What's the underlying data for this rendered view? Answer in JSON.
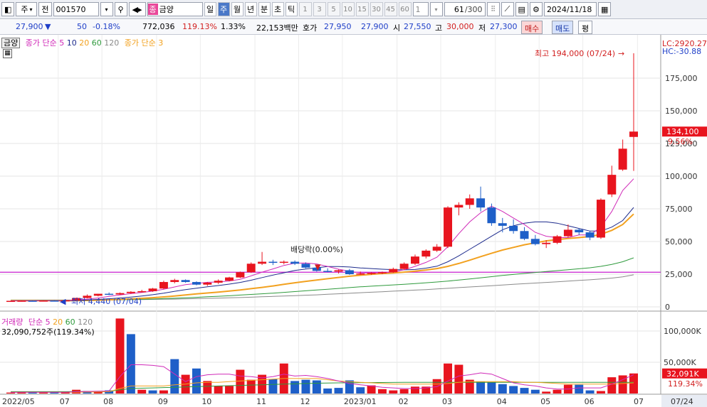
{
  "toolbar": {
    "market": "주",
    "type_label": "전",
    "code": "001570",
    "name": "금양",
    "name_badge": "종",
    "periods": [
      "일",
      "주",
      "월",
      "년",
      "분",
      "초",
      "틱"
    ],
    "active_period": "주",
    "intervals": [
      "1",
      "3",
      "5",
      "10",
      "15",
      "30",
      "45",
      "60"
    ],
    "interval_value": "1",
    "count": "61",
    "count_max": "/300",
    "date": "2024/11/18"
  },
  "quote": {
    "price": "27,900",
    "change": "50",
    "change_pct": "-0.18%",
    "volume": "772,036",
    "vol_ratio": "119.13%",
    "turnover": "1.33%",
    "amount": "22,153백만",
    "hoga_label": "호가",
    "ask": "27,950",
    "bid": "27,900",
    "open_label": "시",
    "open": "27,550",
    "high_label": "고",
    "high": "30,000",
    "low_label": "저",
    "low": "27,300",
    "buy_btn": "매수",
    "sell_btn": "매도",
    "eval_btn": "평"
  },
  "price_panel": {
    "name_tag": "금양",
    "ma_label": "종가 단순",
    "ma_periods": [
      "5",
      "10",
      "20",
      "60",
      "120"
    ],
    "ma_label2": "종가 단순 3",
    "lc": "LC:2920.27",
    "hc": "HC:-30.88",
    "high_annot": "최고 194,000 (07/24)",
    "low_annot": "최저 4,440 (07/04)",
    "dividend_annot": "배당락(0.00%)",
    "last_price_tag": "134,100",
    "last_pct_tag": "9.56%",
    "y_labels": [
      "175,000",
      "150,000",
      "125,000",
      "100,000",
      "75,000",
      "50,000",
      "25,000",
      "0"
    ]
  },
  "volume_panel": {
    "title": "거래량",
    "ma_label": "단순",
    "ma_periods": [
      "5",
      "20",
      "60",
      "120"
    ],
    "value": "32,090,752주(119.34%)",
    "y_labels": [
      "100,000K",
      "50,000K"
    ],
    "last_tag": "32,091K",
    "last_pct": "119.34%"
  },
  "x_axis": [
    "2022/05",
    "07",
    "08",
    "09",
    "10",
    "11",
    "12",
    "2023/01",
    "02",
    "03",
    "04",
    "05",
    "06",
    "07",
    "07/24"
  ],
  "chart_data": {
    "type": "candlestick",
    "ylim": [
      0,
      194000
    ],
    "candles": [
      {
        "o": 4500,
        "h": 4700,
        "l": 4440,
        "c": 4600
      },
      {
        "o": 4600,
        "h": 4800,
        "l": 4500,
        "c": 4700
      },
      {
        "o": 4700,
        "h": 4900,
        "l": 4600,
        "c": 4650
      },
      {
        "o": 4650,
        "h": 4900,
        "l": 4500,
        "c": 4800
      },
      {
        "o": 4800,
        "h": 5000,
        "l": 4600,
        "c": 4700
      },
      {
        "o": 4700,
        "h": 5100,
        "l": 4600,
        "c": 5000
      },
      {
        "o": 5000,
        "h": 7000,
        "l": 4900,
        "c": 6800
      },
      {
        "o": 6800,
        "h": 9500,
        "l": 6500,
        "c": 8500
      },
      {
        "o": 8500,
        "h": 10000,
        "l": 8000,
        "c": 10000
      },
      {
        "o": 10000,
        "h": 11000,
        "l": 9000,
        "c": 9500
      },
      {
        "o": 9500,
        "h": 11000,
        "l": 9200,
        "c": 10500
      },
      {
        "o": 10500,
        "h": 12000,
        "l": 10000,
        "c": 11500
      },
      {
        "o": 11500,
        "h": 13000,
        "l": 11000,
        "c": 12000
      },
      {
        "o": 12000,
        "h": 14500,
        "l": 11500,
        "c": 14000
      },
      {
        "o": 14000,
        "h": 20000,
        "l": 13500,
        "c": 19000
      },
      {
        "o": 19000,
        "h": 21500,
        "l": 18000,
        "c": 20500
      },
      {
        "o": 20500,
        "h": 21000,
        "l": 18500,
        "c": 19000
      },
      {
        "o": 19000,
        "h": 19500,
        "l": 16500,
        "c": 17000
      },
      {
        "o": 17000,
        "h": 19000,
        "l": 16000,
        "c": 18500
      },
      {
        "o": 18500,
        "h": 21000,
        "l": 17500,
        "c": 20000
      },
      {
        "o": 20000,
        "h": 23000,
        "l": 19500,
        "c": 22500
      },
      {
        "o": 22500,
        "h": 27000,
        "l": 22000,
        "c": 26500
      },
      {
        "o": 26500,
        "h": 34000,
        "l": 26000,
        "c": 33000
      },
      {
        "o": 33000,
        "h": 42000,
        "l": 32000,
        "c": 34500
      },
      {
        "o": 34500,
        "h": 36000,
        "l": 32000,
        "c": 34000
      },
      {
        "o": 34000,
        "h": 35500,
        "l": 32500,
        "c": 34500
      },
      {
        "o": 34500,
        "h": 35500,
        "l": 32000,
        "c": 33000
      },
      {
        "o": 33000,
        "h": 34000,
        "l": 29500,
        "c": 30000
      },
      {
        "o": 30000,
        "h": 31000,
        "l": 27000,
        "c": 27500
      },
      {
        "o": 27500,
        "h": 29500,
        "l": 26500,
        "c": 27000
      },
      {
        "o": 27000,
        "h": 28500,
        "l": 25500,
        "c": 28000
      },
      {
        "o": 28000,
        "h": 29000,
        "l": 24500,
        "c": 25000
      },
      {
        "o": 25000,
        "h": 27000,
        "l": 24500,
        "c": 25500
      },
      {
        "o": 25500,
        "h": 26500,
        "l": 24500,
        "c": 26000
      },
      {
        "o": 26000,
        "h": 27000,
        "l": 25000,
        "c": 26500
      },
      {
        "o": 26500,
        "h": 30000,
        "l": 26000,
        "c": 29000
      },
      {
        "o": 29000,
        "h": 34000,
        "l": 28500,
        "c": 33000
      },
      {
        "o": 33000,
        "h": 40000,
        "l": 32000,
        "c": 38500
      },
      {
        "o": 38500,
        "h": 44000,
        "l": 37000,
        "c": 43000
      },
      {
        "o": 43000,
        "h": 48000,
        "l": 42000,
        "c": 46000
      },
      {
        "o": 46000,
        "h": 77000,
        "l": 45000,
        "c": 76000
      },
      {
        "o": 76000,
        "h": 80000,
        "l": 70000,
        "c": 78000
      },
      {
        "o": 78000,
        "h": 86000,
        "l": 75000,
        "c": 83000
      },
      {
        "o": 83000,
        "h": 92000,
        "l": 73000,
        "c": 76000
      },
      {
        "o": 76000,
        "h": 79000,
        "l": 62000,
        "c": 64000
      },
      {
        "o": 64000,
        "h": 68000,
        "l": 57000,
        "c": 62000
      },
      {
        "o": 62000,
        "h": 67000,
        "l": 56000,
        "c": 58000
      },
      {
        "o": 58000,
        "h": 61000,
        "l": 51000,
        "c": 52000
      },
      {
        "o": 52000,
        "h": 55000,
        "l": 47000,
        "c": 48000
      },
      {
        "o": 48000,
        "h": 51000,
        "l": 45000,
        "c": 49000
      },
      {
        "o": 49000,
        "h": 55000,
        "l": 48000,
        "c": 54000
      },
      {
        "o": 54000,
        "h": 63000,
        "l": 53000,
        "c": 59000
      },
      {
        "o": 59000,
        "h": 60000,
        "l": 55000,
        "c": 57000
      },
      {
        "o": 57000,
        "h": 58000,
        "l": 51000,
        "c": 53000
      },
      {
        "o": 53000,
        "h": 83000,
        "l": 52000,
        "c": 82000
      },
      {
        "o": 86000,
        "h": 108000,
        "l": 84000,
        "c": 101000
      },
      {
        "o": 105000,
        "h": 128000,
        "l": 104000,
        "c": 121000
      },
      {
        "o": 130000,
        "h": 194000,
        "l": 104000,
        "c": 134100
      }
    ],
    "volumes_k": [
      1500,
      1800,
      2200,
      1600,
      2000,
      2500,
      6000,
      4000,
      2500,
      5000,
      120000,
      95000,
      6000,
      5000,
      5000,
      55000,
      30000,
      40000,
      20000,
      12000,
      12000,
      38000,
      22000,
      30000,
      23000,
      48000,
      20000,
      22000,
      21000,
      8000,
      9000,
      21000,
      10000,
      13000,
      7000,
      5000,
      7000,
      11000,
      11000,
      23000,
      48000,
      46000,
      22000,
      19000,
      18000,
      15000,
      12000,
      9000,
      6000,
      3000,
      6000,
      14000,
      14000,
      5000,
      4000,
      26000,
      29000,
      32091
    ],
    "volumes_rising": [
      true,
      true,
      false,
      true,
      false,
      true,
      true,
      false,
      true,
      false,
      true,
      false,
      true,
      false,
      true,
      false,
      true,
      false,
      true,
      true,
      true,
      true,
      true,
      true,
      false,
      true,
      false,
      false,
      false,
      false,
      false,
      false,
      false,
      true,
      true,
      true,
      true,
      true,
      true,
      true,
      true,
      true,
      true,
      false,
      false,
      false,
      false,
      false,
      false,
      true,
      true,
      true,
      false,
      false,
      true,
      true,
      true,
      true
    ],
    "ma5": [
      4600,
      4650,
      4650,
      4700,
      4690,
      4770,
      5200,
      5900,
      6800,
      8000,
      9100,
      10100,
      11000,
      12000,
      13400,
      15200,
      17000,
      17900,
      18800,
      19000,
      19800,
      21100,
      23700,
      26600,
      29000,
      31700,
      33400,
      33600,
      32800,
      30900,
      28800,
      27200,
      26000,
      26000,
      26000,
      26800,
      28300,
      31000,
      34000,
      38000,
      46000,
      56000,
      65000,
      72000,
      77000,
      73000,
      68000,
      63000,
      57000,
      54000,
      53000,
      53000,
      55000,
      55000,
      61000,
      73000,
      89000,
      98000
    ],
    "ma10": [
      4600,
      4620,
      4640,
      4650,
      4660,
      4690,
      4900,
      5200,
      5700,
      6200,
      6800,
      7500,
      8300,
      9300,
      10500,
      11900,
      13200,
      14300,
      15300,
      16300,
      17400,
      18700,
      20400,
      22400,
      24300,
      26100,
      27800,
      28900,
      29900,
      30800,
      30800,
      30500,
      29800,
      29300,
      28800,
      28500,
      28300,
      28600,
      29600,
      31100,
      34500,
      39000,
      44000,
      49000,
      54000,
      59000,
      62000,
      64000,
      65000,
      65000,
      64000,
      62000,
      60000,
      58000,
      58000,
      61000,
      66000,
      76000
    ],
    "ma20": [
      4700,
      4700,
      4700,
      4700,
      4700,
      4700,
      4800,
      4900,
      5100,
      5400,
      5700,
      6100,
      6500,
      7000,
      7600,
      8300,
      9100,
      9900,
      10600,
      11300,
      12100,
      12900,
      13900,
      14900,
      16000,
      17200,
      18400,
      19500,
      20500,
      21500,
      22500,
      23400,
      24200,
      24900,
      25500,
      26000,
      26600,
      27300,
      28200,
      29300,
      31000,
      33200,
      35700,
      38400,
      41000,
      43500,
      45500,
      47500,
      49000,
      50500,
      51500,
      52300,
      53000,
      53800,
      55500,
      58500,
      63000,
      71000
    ],
    "ma60": [
      5000,
      5000,
      5000,
      5000,
      5000,
      5000,
      5050,
      5100,
      5200,
      5300,
      5400,
      5600,
      5800,
      6000,
      6300,
      6600,
      6900,
      7300,
      7700,
      8100,
      8500,
      9000,
      9500,
      10000,
      10500,
      11100,
      11700,
      12300,
      12900,
      13500,
      14100,
      14700,
      15300,
      15800,
      16300,
      16800,
      17300,
      17800,
      18400,
      19000,
      19700,
      20500,
      21300,
      22200,
      23100,
      24000,
      24800,
      25600,
      26300,
      27000,
      27700,
      28400,
      29100,
      29900,
      31000,
      32500,
      34500,
      37500
    ],
    "ma120": [
      5200,
      5200,
      5200,
      5200,
      5200,
      5200,
      5200,
      5250,
      5300,
      5350,
      5400,
      5500,
      5600,
      5700,
      5800,
      5950,
      6100,
      6300,
      6500,
      6700,
      6900,
      7100,
      7400,
      7700,
      8000,
      8300,
      8600,
      8900,
      9200,
      9600,
      10000,
      10400,
      10800,
      11200,
      11600,
      12000,
      12400,
      12800,
      13200,
      13700,
      14200,
      14700,
      15200,
      15700,
      16200,
      16700,
      17200,
      17700,
      18200,
      18700,
      19200,
      19700,
      20200,
      20700,
      21300,
      22000,
      23000,
      24500
    ],
    "vol_ma5": [
      1800,
      1900,
      1900,
      2000,
      2000,
      2100,
      3000,
      3300,
      3800,
      4000,
      27000,
      46000,
      46000,
      45000,
      43000,
      31000,
      19000,
      27000,
      30000,
      31000,
      31000,
      28000,
      27000,
      25000,
      27000,
      31000,
      28000,
      29000,
      27000,
      24000,
      20000,
      16000,
      14000,
      12000,
      10000,
      9000,
      8000,
      8000,
      9000,
      11000,
      20000,
      28000,
      30000,
      33000,
      31000,
      24000,
      17000,
      14000,
      12000,
      9000,
      7000,
      7000,
      9000,
      9000,
      9000,
      15000,
      22000,
      30000
    ],
    "vol_ma20": [
      2000,
      2000,
      2000,
      2000,
      2000,
      2000,
      2200,
      2400,
      2600,
      2800,
      8000,
      12000,
      12000,
      12000,
      12000,
      14000,
      15000,
      17000,
      18000,
      18000,
      19000,
      20000,
      21000,
      22000,
      23000,
      24000,
      24000,
      24000,
      24000,
      22000,
      20000,
      19000,
      18000,
      17000,
      16000,
      15000,
      15000,
      15000,
      15000,
      15000,
      16000,
      18000,
      19000,
      19000,
      19000,
      19000,
      19000,
      18000,
      18000,
      17000,
      16000,
      15000,
      15000,
      15000,
      15000,
      15000,
      16000,
      17000
    ],
    "vol_ma60": [
      3000,
      3000,
      3000,
      3000,
      3000,
      3000,
      3100,
      3200,
      3300,
      3400,
      6000,
      8000,
      8500,
      9000,
      9500,
      10000,
      10500,
      11000,
      11500,
      12000,
      12500,
      13000,
      13500,
      14000,
      14500,
      15000,
      15500,
      16000,
      16500,
      16800,
      17000,
      17200,
      17400,
      17500,
      17600,
      17700,
      17800,
      17800,
      17800,
      17800,
      17800,
      17800,
      17800,
      17800,
      17800,
      17800,
      17800,
      17800,
      17800,
      17800,
      17800,
      17800,
      17800,
      17800,
      17800,
      17800,
      17800,
      17800
    ]
  },
  "colors": {
    "up": "#e8141e",
    "down": "#1e5fc8",
    "ma5": "#d02ab8",
    "ma10": "#1c2a8c",
    "ma20": "#f2a11f",
    "ma60": "#2e9a3c",
    "ma120": "#8a8a8a",
    "hline": "#c81ed0"
  }
}
